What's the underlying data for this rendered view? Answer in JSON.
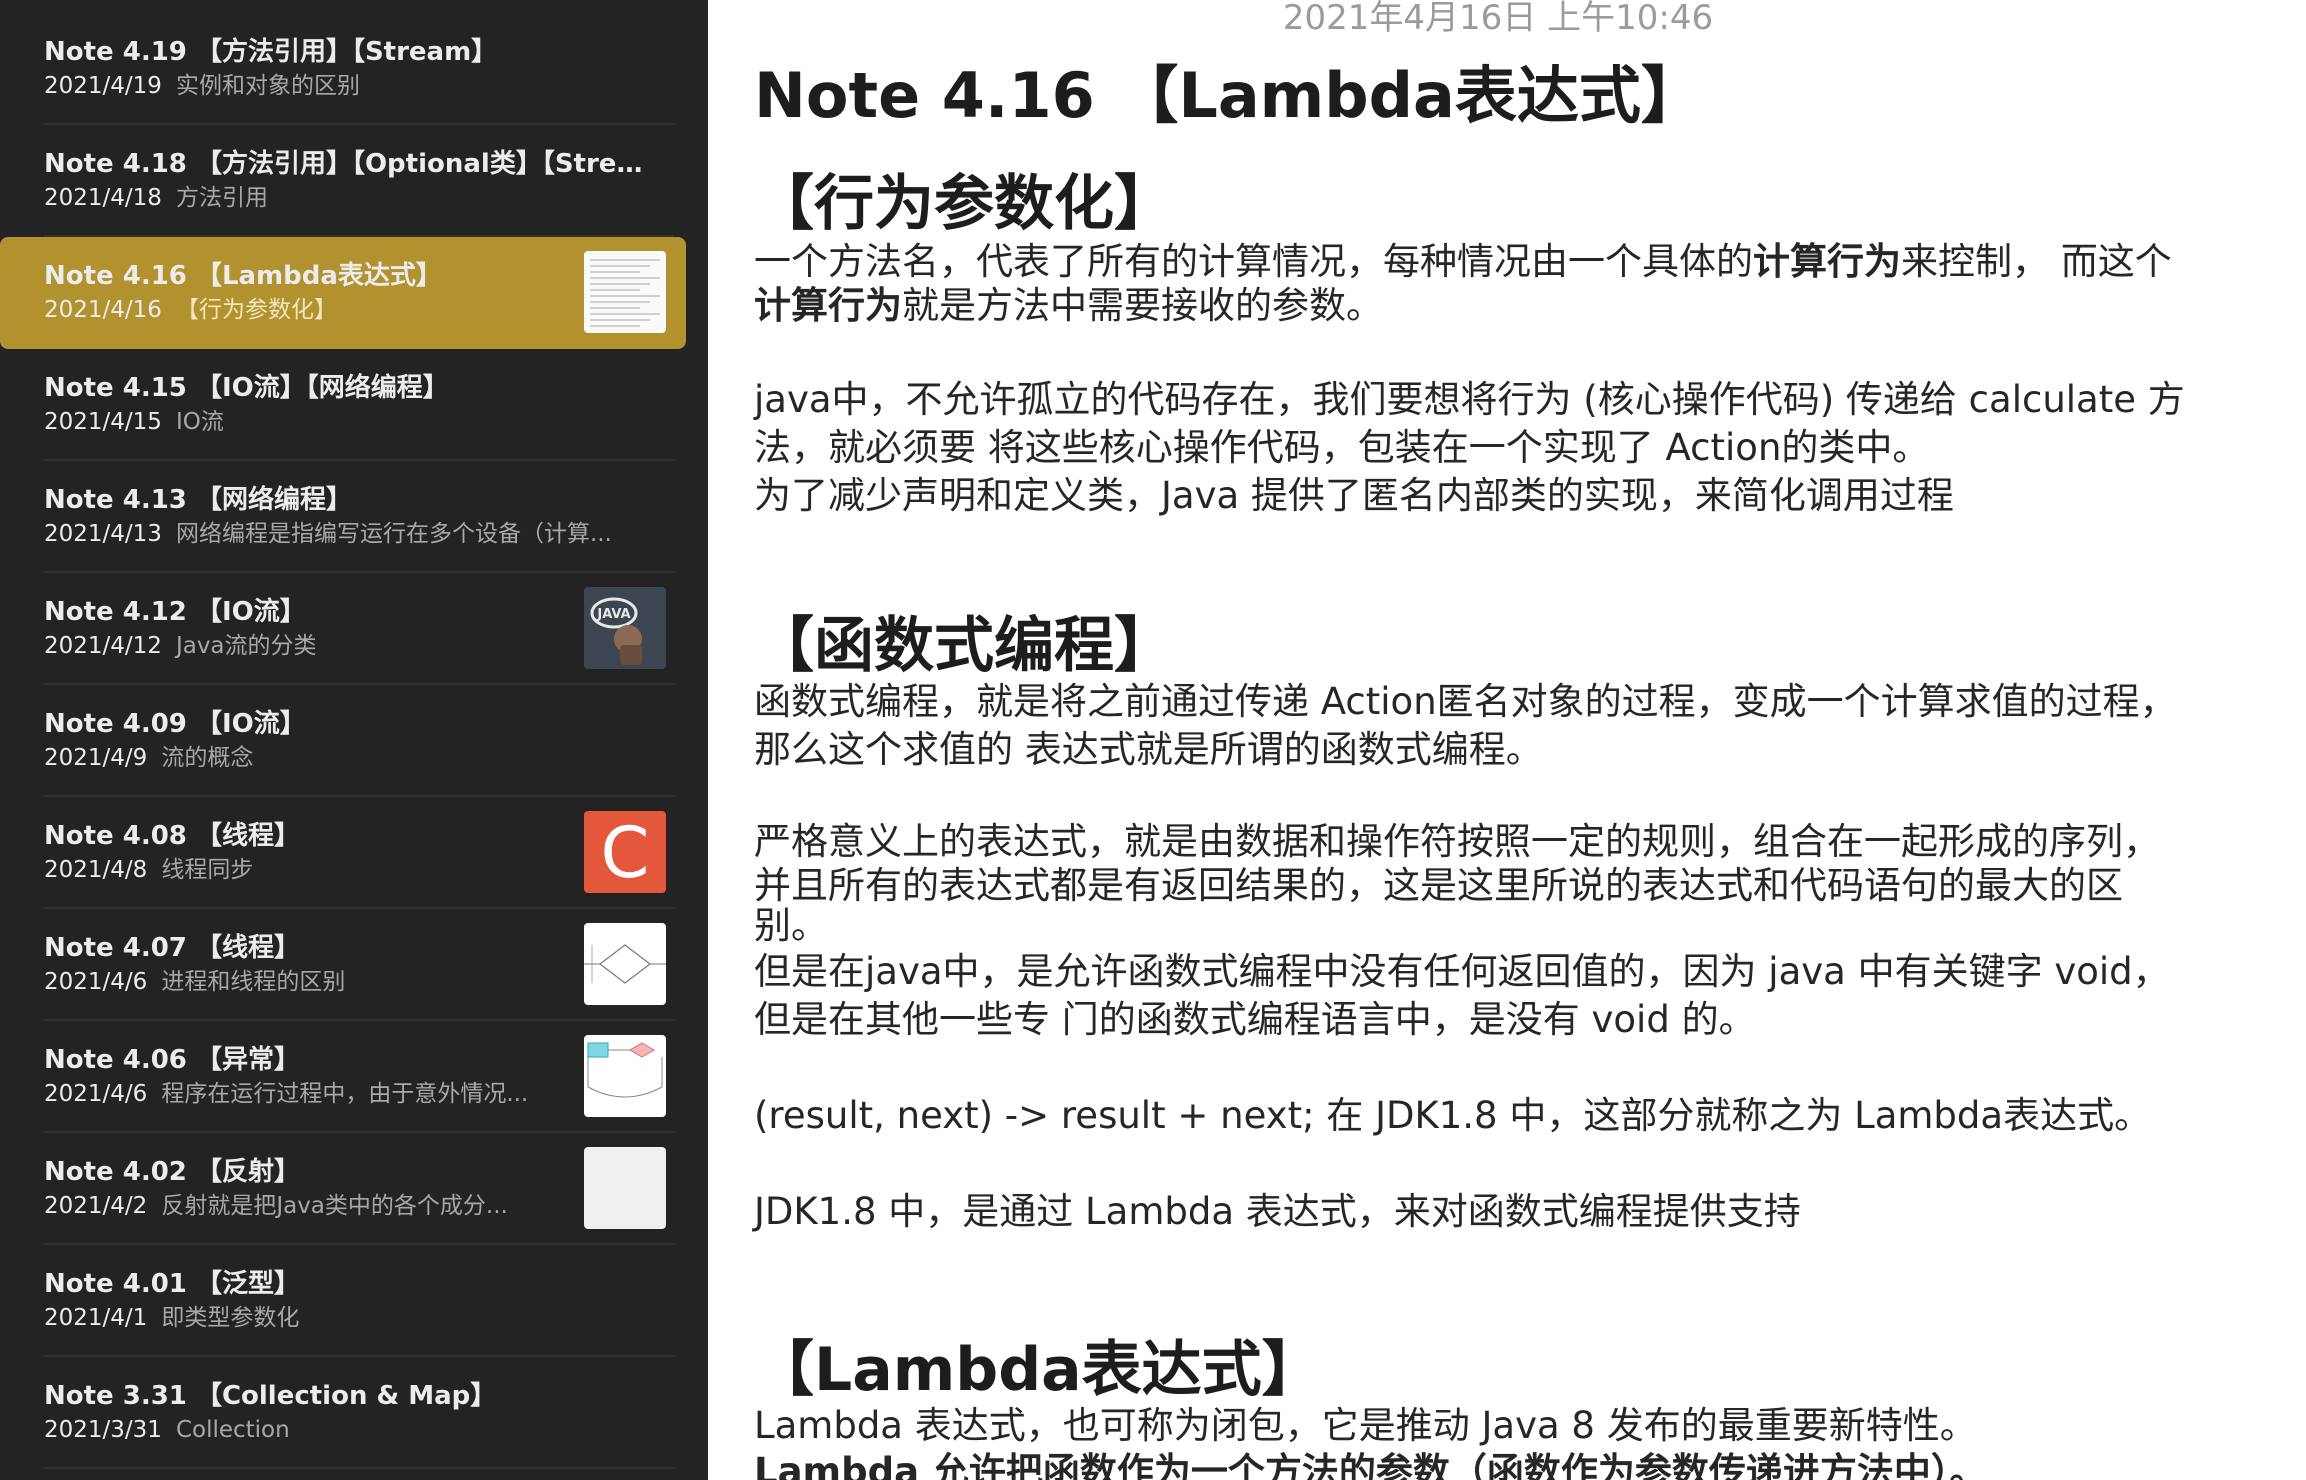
{
  "sidebar": {
    "notes": [
      {
        "title": "Note 4.19 【方法引用】【Stream】",
        "date": "2021/4/19",
        "preview": "实例和对象的区别",
        "thumb": null,
        "selected": false
      },
      {
        "title": "Note 4.18 【方法引用】【Optional类】【Stre...",
        "date": "2021/4/18",
        "preview": "方法引用",
        "thumb": null,
        "selected": false
      },
      {
        "title": "Note 4.16 【Lambda表达式】",
        "date": "2021/4/16",
        "preview": "【行为参数化】",
        "thumb": "document",
        "selected": true
      },
      {
        "title": "Note 4.15 【IO流】【网络编程】",
        "date": "2021/4/15",
        "preview": "IO流",
        "thumb": null,
        "selected": false
      },
      {
        "title": "Note 4.13 【网络编程】",
        "date": "2021/4/13",
        "preview": "网络编程是指编写运行在多个设备（计算...",
        "thumb": null,
        "selected": false
      },
      {
        "title": "Note 4.12 【IO流】",
        "date": "2021/4/12",
        "preview": "Java流的分类",
        "thumb": "java-logo",
        "selected": false
      },
      {
        "title": "Note 4.09 【IO流】",
        "date": "2021/4/9",
        "preview": "流的概念",
        "thumb": null,
        "selected": false
      },
      {
        "title": "Note 4.08 【线程】",
        "date": "2021/4/8",
        "preview": "线程同步",
        "thumb": "c-logo",
        "selected": false
      },
      {
        "title": "Note 4.07 【线程】",
        "date": "2021/4/6",
        "preview": "进程和线程的区别",
        "thumb": "diagram-diamond",
        "selected": false
      },
      {
        "title": "Note 4.06 【异常】",
        "date": "2021/4/6",
        "preview": "程序在运行过程中，由于意外情况...",
        "thumb": "diagram-flow",
        "selected": false
      },
      {
        "title": "Note 4.02 【反射】",
        "date": "2021/4/2",
        "preview": "反射就是把Java类中的各个成分...",
        "thumb": "blank",
        "selected": false
      },
      {
        "title": "Note 4.01 【泛型】",
        "date": "2021/4/1",
        "preview": "即类型参数化",
        "thumb": null,
        "selected": false
      },
      {
        "title": "Note 3.31 【Collection & Map】",
        "date": "2021/3/31",
        "preview": "Collection",
        "thumb": null,
        "selected": false
      }
    ],
    "java_logo_text": "JAVA",
    "c_logo_text": "C"
  },
  "editor": {
    "timestamp": "2021年4月16日 上午10:46",
    "title": "Note 4.16 【Lambda表达式】",
    "section1": {
      "heading": "【行为参数化】",
      "p1_line1_a": "一个方法名，代表了所有的计算情况，每种情况由一个具体的",
      "p1_line1_b": "计算行为",
      "p1_line1_c": "来控制， 而这个",
      "p1_line2_a": "计算行为",
      "p1_line2_b": "就是方法中需要接收的参数。",
      "p2_line1": "java中，不允许孤立的代码存在，我们要想将行为 (核心操作代码) 传递给 calculate 方",
      "p2_line2": "法，就必须要 将这些核心操作代码，包装在一个实现了 Action的类中。",
      "p2_line3": "为了减少声明和定义类，Java 提供了匿名内部类的实现，来简化调用过程"
    },
    "section2": {
      "heading": "【函数式编程】",
      "p1_line1": "函数式编程，就是将之前通过传递 Action匿名对象的过程，变成一个计算求值的过程，",
      "p1_line2": "那么这个求值的 表达式就是所谓的函数式编程。",
      "p2_line1": "严格意义上的表达式，就是由数据和操作符按照一定的规则，组合在一起形成的序列，",
      "p2_line2": "并且所有的表达式都是有返回结果的，这是这里所说的表达式和代码语句的最大的区",
      "p2_line3": "别。",
      "p2_line4": "但是在java中，是允许函数式编程中没有任何返回值的，因为 java 中有关键字 void，",
      "p2_line5": "但是在其他一些专 门的函数式编程语言中，是没有 void 的。",
      "p3": "(result, next) -> result + next; 在 JDK1.8 中，这部分就称之为 Lambda表达式。",
      "p4": "JDK1.8 中，是通过 Lambda 表达式，来对函数式编程提供支持"
    },
    "section3": {
      "heading": "【Lambda表达式】",
      "p1": "Lambda 表达式，也可称为闭包，它是推动 Java 8 发布的最重要新特性。",
      "p2": "Lambda 允许把函数作为一个方法的参数（函数作为参数传递进方法中）。"
    }
  }
}
